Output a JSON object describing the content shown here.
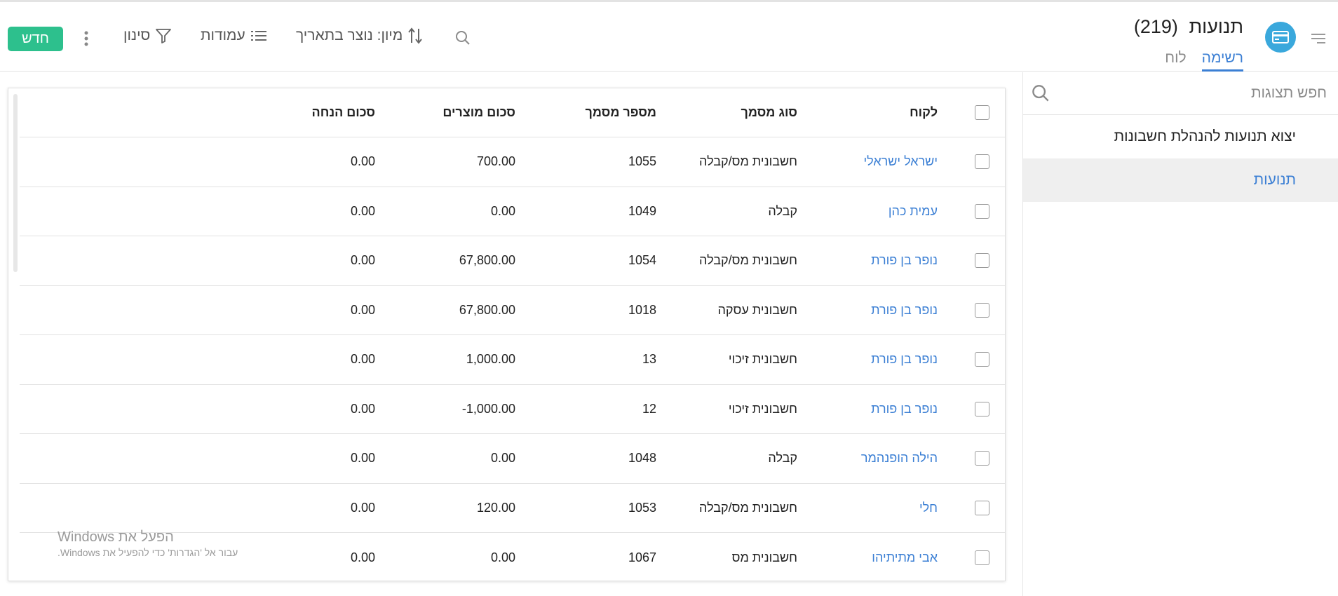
{
  "header": {
    "title": "תנועות",
    "count": "(219)",
    "tabs": [
      {
        "label": "רשימה",
        "active": true
      },
      {
        "label": "לוח",
        "active": false
      }
    ],
    "sort_label": "מיון: נוצר בתאריך",
    "columns_label": "עמודות",
    "filter_label": "סינון",
    "new_button": "חדש",
    "icons": {
      "menu": "hamburger-icon",
      "app": "credit-card-icon",
      "search": "search-icon",
      "sort": "sort-arrows-icon",
      "columns": "list-icon",
      "filter": "funnel-icon",
      "more": "kebab-icon"
    }
  },
  "sidebar": {
    "search_placeholder": "חפש תצוגות",
    "export_label": "יצוא תנועות להנהלת חשבונות",
    "active_item": "תנועות"
  },
  "table": {
    "headers": {
      "customer": "לקוח",
      "doc_type": "סוג מסמך",
      "doc_number": "מספר מסמך",
      "products_sum": "סכום מוצרים",
      "discount_sum": "סכום הנחה"
    },
    "rows": [
      {
        "customer": "ישראל ישראלי",
        "doc_type": "חשבונית מס/קבלה",
        "doc_number": "1055",
        "products_sum": "700.00",
        "discount_sum": "0.00"
      },
      {
        "customer": "עמית כהן",
        "doc_type": "קבלה",
        "doc_number": "1049",
        "products_sum": "0.00",
        "discount_sum": "0.00"
      },
      {
        "customer": "נופר בן פורת",
        "doc_type": "חשבונית מס/קבלה",
        "doc_number": "1054",
        "products_sum": "67,800.00",
        "discount_sum": "0.00"
      },
      {
        "customer": "נופר בן פורת",
        "doc_type": "חשבונית עסקה",
        "doc_number": "1018",
        "products_sum": "67,800.00",
        "discount_sum": "0.00"
      },
      {
        "customer": "נופר בן פורת",
        "doc_type": "חשבונית זיכוי",
        "doc_number": "13",
        "products_sum": "1,000.00",
        "discount_sum": "0.00"
      },
      {
        "customer": "נופר בן פורת",
        "doc_type": "חשבונית זיכוי",
        "doc_number": "12",
        "products_sum": "1,000.00-",
        "discount_sum": "0.00"
      },
      {
        "customer": "הילה הופנהמר",
        "doc_type": "קבלה",
        "doc_number": "1048",
        "products_sum": "0.00",
        "discount_sum": "0.00"
      },
      {
        "customer": "חלי",
        "doc_type": "חשבונית מס/קבלה",
        "doc_number": "1053",
        "products_sum": "120.00",
        "discount_sum": "0.00"
      },
      {
        "customer": "אבי מתיתיהו",
        "doc_type": "חשבונית מס",
        "doc_number": "1067",
        "products_sum": "0.00",
        "discount_sum": "0.00"
      }
    ]
  },
  "watermark": {
    "title": "הפעל את Windows",
    "subtitle": "עבור אל 'הגדרות' כדי להפעיל את Windows."
  },
  "colors": {
    "accent": "#3b7fd4",
    "new_button": "#2dc08d",
    "app_badge": "#3aa8dc"
  }
}
